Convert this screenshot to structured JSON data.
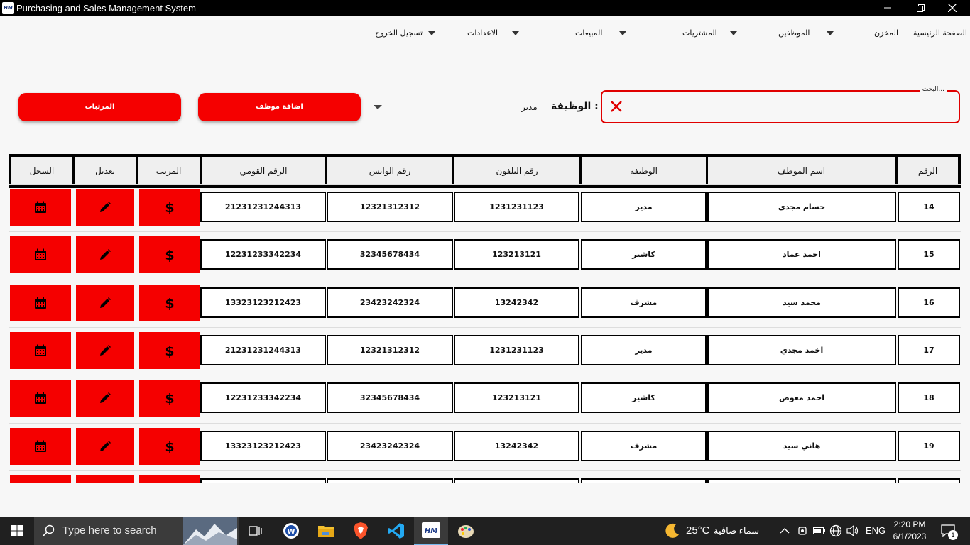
{
  "window": {
    "title": "Purchasing and Sales Management System",
    "logo_text": "HM"
  },
  "menu": {
    "items": [
      {
        "label": "الصفحة الرئيسية"
      },
      {
        "label": "المخزن"
      },
      {
        "label": "الموظفين"
      },
      {
        "label": "المشتريات"
      },
      {
        "label": "المبيعات"
      },
      {
        "label": "الاعدادات"
      },
      {
        "label": "تسجيل الخروج"
      }
    ]
  },
  "search": {
    "label": "البحث...",
    "value": ""
  },
  "filter": {
    "label": "الوظيفة :",
    "value": "مدير"
  },
  "buttons": {
    "add_employee": "اضافة موظف",
    "salaries": "المرتبات"
  },
  "table": {
    "headers": [
      "الرقم",
      "اسم الموظف",
      "الوظيفة",
      "رقم التلفون",
      "رقم الواتس",
      "الرقم القومي",
      "المرتب",
      "تعديل",
      "السجل"
    ],
    "rows": [
      {
        "id": "14",
        "name": "حسام مجدي",
        "job": "مدير",
        "phone": "1231231123",
        "whats": "12321312312",
        "national_id": "21231231244313"
      },
      {
        "id": "15",
        "name": "احمد عماد",
        "job": "كاشير",
        "phone": "123213121",
        "whats": "32345678434",
        "national_id": "12231233342234"
      },
      {
        "id": "16",
        "name": "محمد سيد",
        "job": "مشرف",
        "phone": "13242342",
        "whats": "23423242324",
        "national_id": "13323123212423"
      },
      {
        "id": "17",
        "name": "اخمد مجدي",
        "job": "مدير",
        "phone": "1231231123",
        "whats": "12321312312",
        "national_id": "21231231244313"
      },
      {
        "id": "18",
        "name": "احمد معوض",
        "job": "كاشير",
        "phone": "123213121",
        "whats": "32345678434",
        "national_id": "12231233342234"
      },
      {
        "id": "19",
        "name": "هاني سيد",
        "job": "مشرف",
        "phone": "13242342",
        "whats": "23423242324",
        "national_id": "13323123212423"
      }
    ]
  },
  "taskbar": {
    "search_placeholder": "Type here to search",
    "temperature": "25°C",
    "weather": "سماء صافية",
    "language": "ENG",
    "time": "2:20 PM",
    "date": "6/1/2023",
    "notifications": "1"
  },
  "colors": {
    "accent": "#f50000",
    "titlebar": "#000000",
    "taskbar": "#202020"
  }
}
